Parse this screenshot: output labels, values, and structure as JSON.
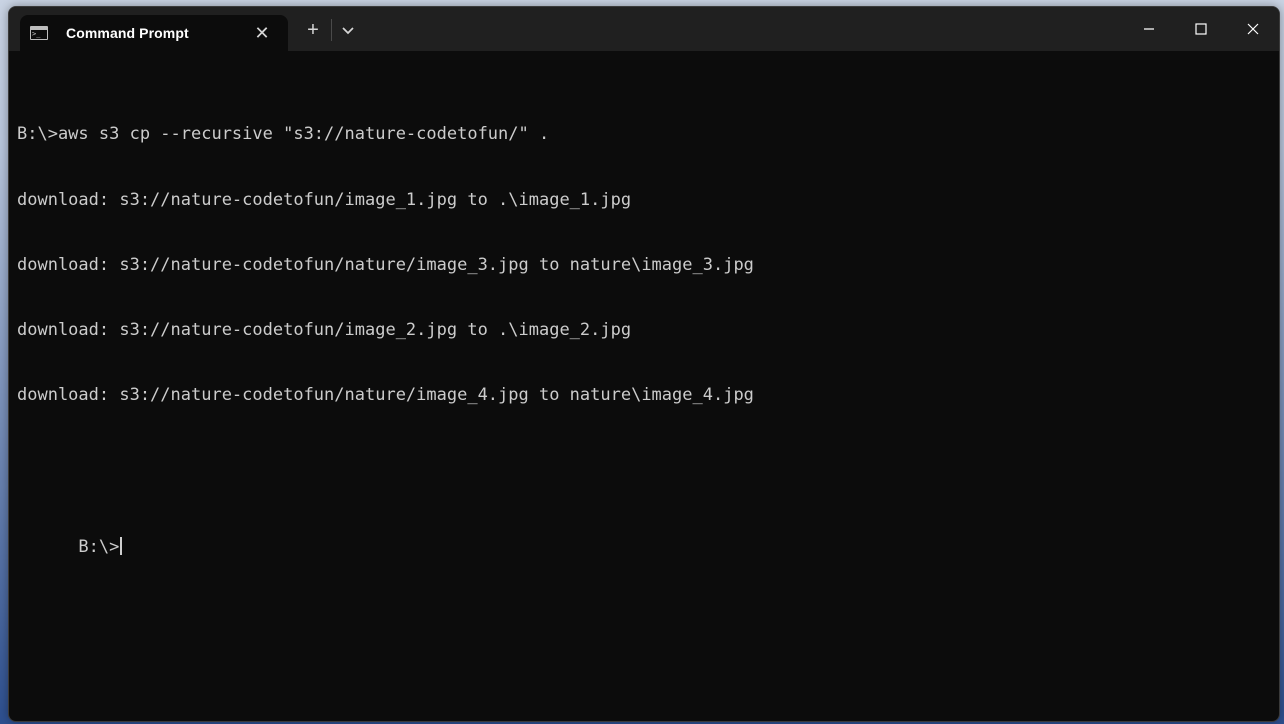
{
  "window": {
    "tab_title": "Command Prompt"
  },
  "terminal": {
    "lines": [
      "B:\\>aws s3 cp --recursive \"s3://nature-codetofun/\" .",
      "download: s3://nature-codetofun/image_1.jpg to .\\image_1.jpg",
      "download: s3://nature-codetofun/nature/image_3.jpg to nature\\image_3.jpg",
      "download: s3://nature-codetofun/image_2.jpg to .\\image_2.jpg",
      "download: s3://nature-codetofun/nature/image_4.jpg to nature\\image_4.jpg"
    ],
    "prompt": "B:\\>"
  },
  "colors": {
    "terminal_bg": "#0c0c0c",
    "titlebar_bg": "#202020",
    "text": "#cccccc"
  },
  "icons": {
    "tab_icon": "terminal-icon",
    "tab_close": "close-icon",
    "new_tab": "plus-icon",
    "dropdown": "chevron-down-icon",
    "minimize": "minimize-icon",
    "maximize": "maximize-icon",
    "close": "close-icon"
  }
}
